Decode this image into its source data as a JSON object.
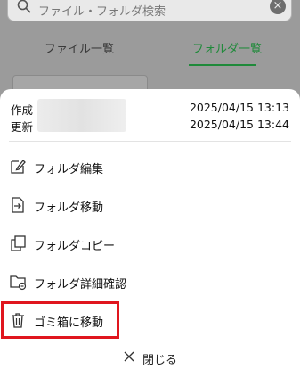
{
  "search": {
    "placeholder": "ファイル・フォルダ検索"
  },
  "tabs": [
    {
      "label": "ファイル一覧",
      "active": false
    },
    {
      "label": "フォルダ一覧",
      "active": true
    }
  ],
  "meta": {
    "created_label": "作成",
    "created_value": "2025/04/15 13:13",
    "updated_label": "更新",
    "updated_value": "2025/04/15 13:44"
  },
  "menu": {
    "items": [
      {
        "label": "フォルダ編集",
        "icon": "edit-icon"
      },
      {
        "label": "フォルダ移動",
        "icon": "move-icon"
      },
      {
        "label": "フォルダコピー",
        "icon": "copy-icon"
      },
      {
        "label": "フォルダ詳細確認",
        "icon": "folder-info-icon"
      },
      {
        "label": "ゴミ箱に移動",
        "icon": "trash-icon",
        "highlighted": true
      }
    ],
    "close_label": "閉じる"
  },
  "colors": {
    "accent": "#1f8a3a",
    "highlight": "#e0161e"
  }
}
